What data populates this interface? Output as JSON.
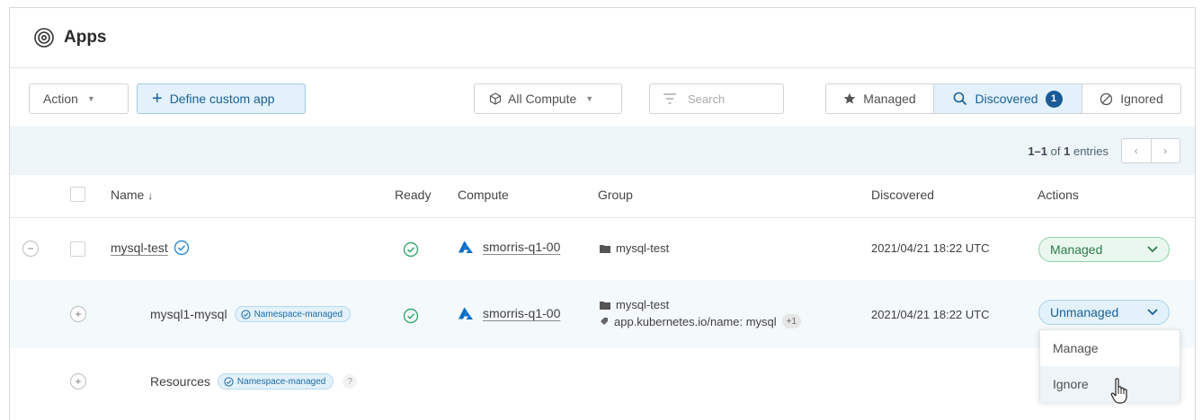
{
  "header": {
    "title": "Apps"
  },
  "toolbar": {
    "action_label": "Action",
    "define_label": "Define custom app",
    "compute_label": "All Compute",
    "search_placeholder": "Search",
    "filters": {
      "managed": "Managed",
      "discovered": "Discovered",
      "discovered_count": "1",
      "ignored": "Ignored"
    }
  },
  "pagination": {
    "range": "1–1",
    "of": "of",
    "total": "1",
    "suffix": "entries",
    "prev": "‹",
    "next": "›"
  },
  "table": {
    "headers": {
      "name": "Name",
      "sort": "↓",
      "ready": "Ready",
      "compute": "Compute",
      "group": "Group",
      "discovered": "Discovered",
      "actions": "Actions"
    },
    "rows": [
      {
        "name": "mysql-test",
        "compute": "smorris-q1-00",
        "group": "mysql-test",
        "discovered": "2021/04/21 18:22 UTC",
        "action": "Managed"
      },
      {
        "name": "mysql1-mysql",
        "tag": "Namespace-managed",
        "compute": "smorris-q1-00",
        "group": "mysql-test",
        "label": "app.kubernetes.io/name: mysql",
        "label_more": "+1",
        "discovered": "2021/04/21 18:22 UTC",
        "action": "Unmanaged"
      },
      {
        "name": "Resources",
        "tag": "Namespace-managed",
        "help": "?"
      }
    ]
  },
  "dropdown": {
    "items": [
      "Manage",
      "Ignore"
    ]
  },
  "colors": {
    "accent": "#1a5f95",
    "managed": "#2c7b4b",
    "ready": "#3aa76d",
    "azure": "#0a6fc7"
  }
}
